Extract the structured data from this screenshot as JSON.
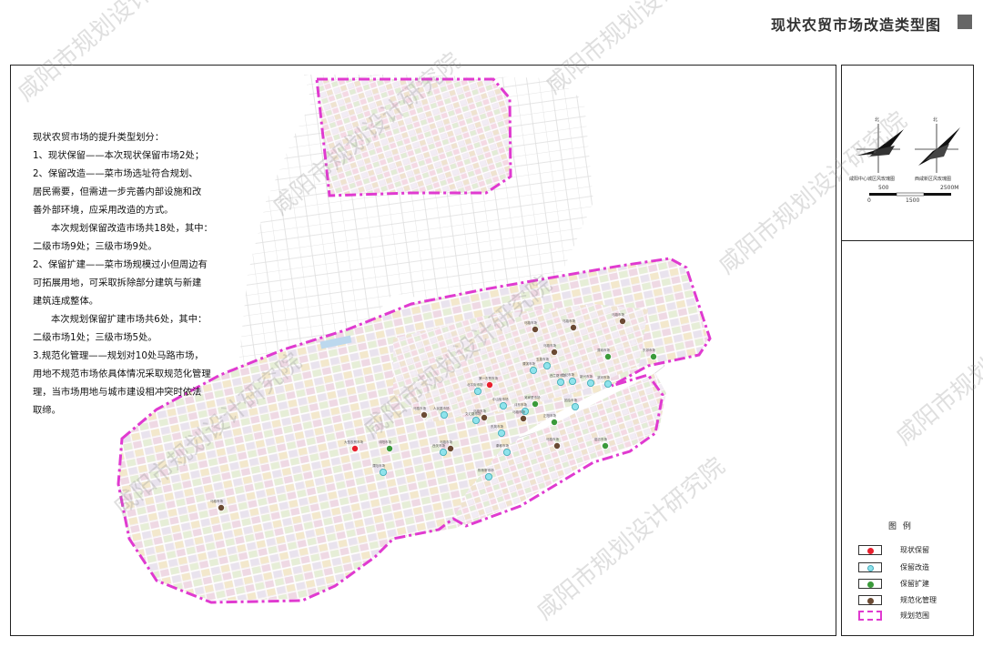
{
  "title": "现状农贸市场改造类型图",
  "notes": [
    "现状农贸市场的提升类型划分：",
    "1、现状保留——本次现状保留市场2处；",
    "2、保留改造——菜市场选址符合规划、",
    "居民需要，但需进一步完善内部设施和改",
    "善外部环境，应采用改造的方式。",
    "本次规划保留改造市场共18处，其中：",
    "二级市场9处；三级市场9处。",
    "2、保留扩建——菜市场规模过小但周边有",
    "可拓展用地，可采取拆除部分建筑与新建",
    "建筑连成整体。",
    "本次规划保留扩建市场共6处，其中：",
    "二级市场1处；三级市场5处。",
    "3.规范化管理——规划对10处马路市场，",
    "用地不规范市场依具体情况采取规范化管理",
    "理，当市场用地与城市建设相冲突时依法",
    "取缔。"
  ],
  "compass": {
    "north_label": "北",
    "caption_left": "咸阳中心城区风玫瑰图",
    "caption_right": "西咸新区风玫瑰图",
    "scale_ticks": [
      "0",
      "500",
      "1500",
      "2500M"
    ]
  },
  "legend": {
    "title": "图 例",
    "items": [
      {
        "label": "现状保留",
        "color": "#e8202e"
      },
      {
        "label": "保留改造",
        "color": "#8fe3ec"
      },
      {
        "label": "保留扩建",
        "color": "#3a9a3a"
      },
      {
        "label": "规范化管理",
        "color": "#6b4a33"
      },
      {
        "label": "规划范围",
        "color": "#e03ad0"
      }
    ]
  },
  "watermark": "咸阳市规划设计研究院",
  "markets": [
    {
      "type": "现状保留",
      "color": "#e8202e",
      "label": "大型农贸市场"
    },
    {
      "type": "现状保留",
      "color": "#e8202e",
      "label": "第一农贸市场"
    },
    {
      "type": "保留改造",
      "color": "#8fe3ec",
      "label": "渭阳市场"
    },
    {
      "type": "保留改造",
      "color": "#8fe3ec",
      "label": "人民路市场"
    },
    {
      "type": "保留改造",
      "color": "#8fe3ec",
      "label": "北平街市场"
    },
    {
      "type": "保留改造",
      "color": "#8fe3ec",
      "label": "中山街市场"
    },
    {
      "type": "保留改造",
      "color": "#8fe3ec",
      "label": "文汇路市场"
    },
    {
      "type": "保留改造",
      "color": "#8fe3ec",
      "label": "东风市场"
    },
    {
      "type": "保留改造",
      "color": "#8fe3ec",
      "label": "渭滨市场"
    },
    {
      "type": "保留改造",
      "color": "#8fe3ec",
      "label": "玉泉市场"
    },
    {
      "type": "保留改造",
      "color": "#8fe3ec",
      "label": "西兰路市场"
    },
    {
      "type": "保留改造",
      "color": "#8fe3ec",
      "label": "世纪市场"
    },
    {
      "type": "保留改造",
      "color": "#8fe3ec",
      "label": "新兴市场"
    },
    {
      "type": "保留改造",
      "color": "#8fe3ec",
      "label": "沣东市场"
    },
    {
      "type": "保留改造",
      "color": "#8fe3ec",
      "label": "秦都市场"
    },
    {
      "type": "保留改造",
      "color": "#8fe3ec",
      "label": "陈杨寨市场"
    },
    {
      "type": "保留改造",
      "color": "#8fe3ec",
      "label": "西关市场"
    },
    {
      "type": "保留改造",
      "color": "#8fe3ec",
      "label": "团结市场"
    },
    {
      "type": "保留改造",
      "color": "#8fe3ec",
      "label": "滨河市场"
    },
    {
      "type": "保留扩建",
      "color": "#3a9a3a",
      "label": "沣阳市场"
    },
    {
      "type": "保留扩建",
      "color": "#3a9a3a",
      "label": "吴家堡市场"
    },
    {
      "type": "保留扩建",
      "color": "#3a9a3a",
      "label": "渭城市场"
    },
    {
      "type": "保留扩建",
      "color": "#3a9a3a",
      "label": "东郊市场"
    },
    {
      "type": "保留扩建",
      "color": "#3a9a3a",
      "label": "正阳市场"
    },
    {
      "type": "保留扩建",
      "color": "#3a9a3a",
      "label": "窑店市场"
    },
    {
      "type": "规范化管理",
      "color": "#6b4a33",
      "label": "马路市场"
    },
    {
      "type": "规范化管理",
      "color": "#6b4a33",
      "label": "马路市场"
    },
    {
      "type": "规范化管理",
      "color": "#6b4a33",
      "label": "马路市场"
    },
    {
      "type": "规范化管理",
      "color": "#6b4a33",
      "label": "马路市场"
    },
    {
      "type": "规范化管理",
      "color": "#6b4a33",
      "label": "马路市场"
    },
    {
      "type": "规范化管理",
      "color": "#6b4a33",
      "label": "马路市场"
    },
    {
      "type": "规范化管理",
      "color": "#6b4a33",
      "label": "马路市场"
    },
    {
      "type": "规范化管理",
      "color": "#6b4a33",
      "label": "马路市场"
    },
    {
      "type": "规范化管理",
      "color": "#6b4a33",
      "label": "马路市场"
    },
    {
      "type": "规范化管理",
      "color": "#6b4a33",
      "label": "马路市场"
    }
  ]
}
